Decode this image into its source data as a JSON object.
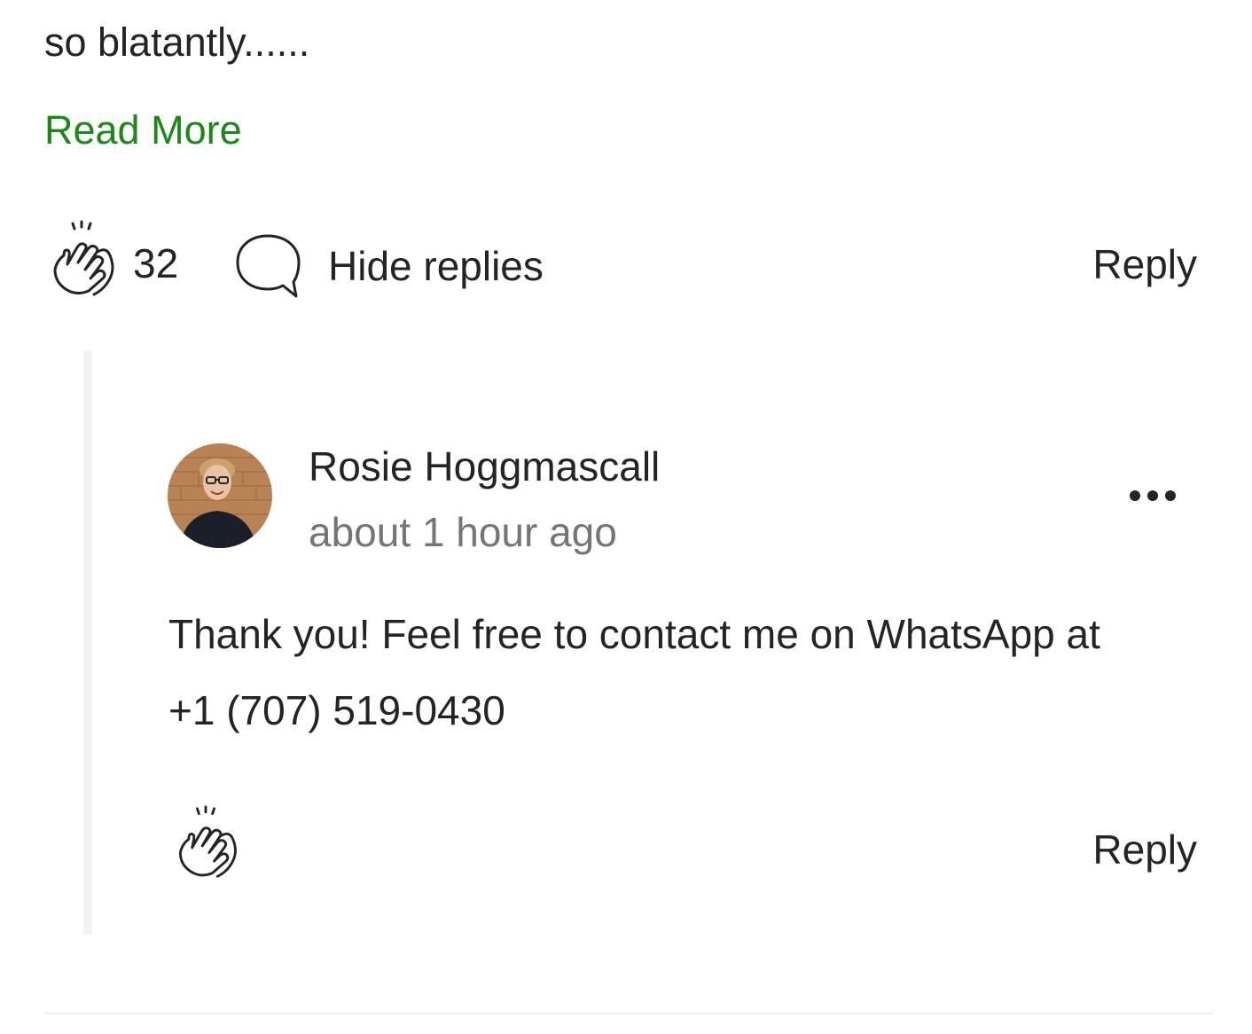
{
  "comment": {
    "text_tail": "so blatantly......",
    "read_more_label": "Read More",
    "clap_count": "32",
    "hide_replies_label": "Hide replies",
    "reply_label": "Reply"
  },
  "reply": {
    "author_name": "Rosie Hoggmascall",
    "timestamp": "about 1 hour ago",
    "text_line1": "Thank you! Feel free to contact me on WhatsApp at",
    "text_line2": "+1 (707) 519-0430",
    "reply_label": "Reply"
  },
  "icons": {
    "clap": "clap-icon",
    "comment": "speech-bubble-icon",
    "more": "more-options-icon"
  },
  "colors": {
    "accent_link": "#1a8917",
    "text": "#242424",
    "muted": "#757575",
    "thread_line": "#f2f2f2"
  }
}
